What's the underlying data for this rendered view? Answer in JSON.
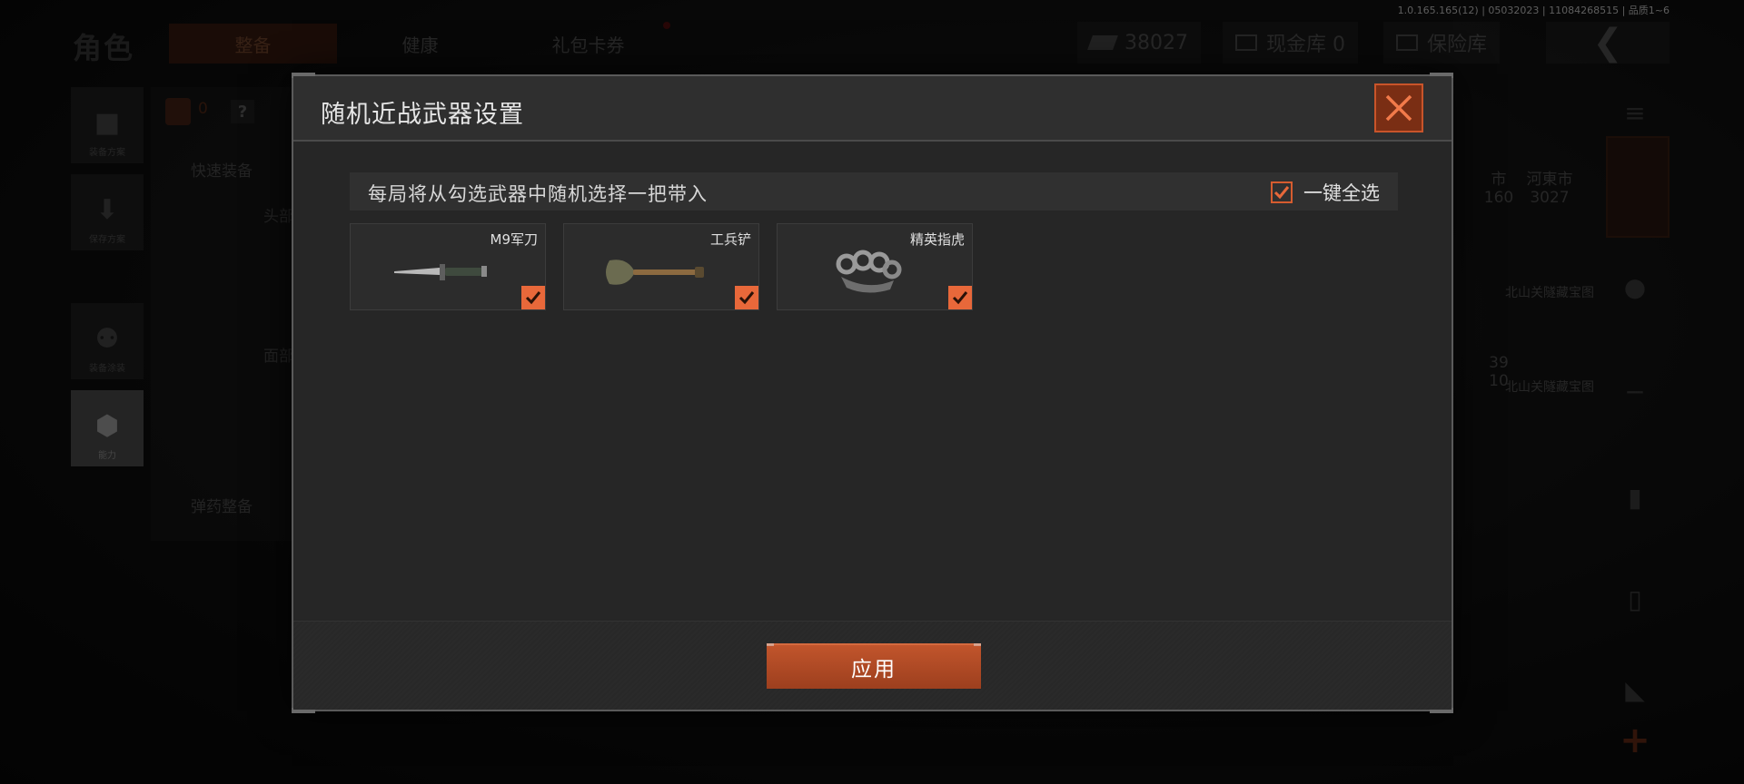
{
  "version_text": "1.0.165.165(12) | 05032023 | 11084268515 | 品质1~6",
  "background": {
    "page_title": "角色",
    "tabs": [
      {
        "label": "整备",
        "active": true
      },
      {
        "label": "健康",
        "active": false
      },
      {
        "label": "礼包卡券",
        "active": false
      }
    ],
    "currency_value": "38027",
    "cash_vault_label": "现金库 0",
    "safe_vault_label": "保险库",
    "back_icon": "chevron-left-icon",
    "left_nav": [
      {
        "label": "装备方案",
        "icon": "vest-icon",
        "selected": false
      },
      {
        "label": "保存方案",
        "icon": "download-icon",
        "selected": false
      },
      {
        "label": "装备涂装",
        "icon": "mask-icon",
        "selected": false
      },
      {
        "label": "能力",
        "icon": "lightning-hex-icon",
        "selected": true
      }
    ],
    "vest_count": "0",
    "help_label": "?",
    "quick_equip_label": "快速装备",
    "head_slot_label": "头部",
    "face_slot_label": "面部",
    "ammo_label": "弹药整备",
    "inventory_cells": [
      {
        "title": "市",
        "count": "160"
      },
      {
        "title": "河東市",
        "count": "3027"
      },
      {
        "title": "北山关隧藏宝图",
        "count": ""
      },
      {
        "title": "39",
        "count": "10"
      },
      {
        "title": "北山关隧藏宝图",
        "count": ""
      }
    ],
    "add_label": "+"
  },
  "modal": {
    "title": "随机近战武器设置",
    "close_icon": "close-icon",
    "hint": "每局将从勾选武器中随机选择一把带入",
    "select_all_label": "一键全选",
    "select_all_checked": true,
    "weapons": [
      {
        "name": "M9军刀",
        "icon": "bayonet-knife-icon",
        "checked": true
      },
      {
        "name": "工兵铲",
        "icon": "shovel-icon",
        "checked": true
      },
      {
        "name": "精英指虎",
        "icon": "brass-knuckles-icon",
        "checked": true
      }
    ],
    "apply_label": "应用"
  },
  "colors": {
    "accent": "#c1552c",
    "check": "#e8683a",
    "modal_bg": "#262626"
  }
}
